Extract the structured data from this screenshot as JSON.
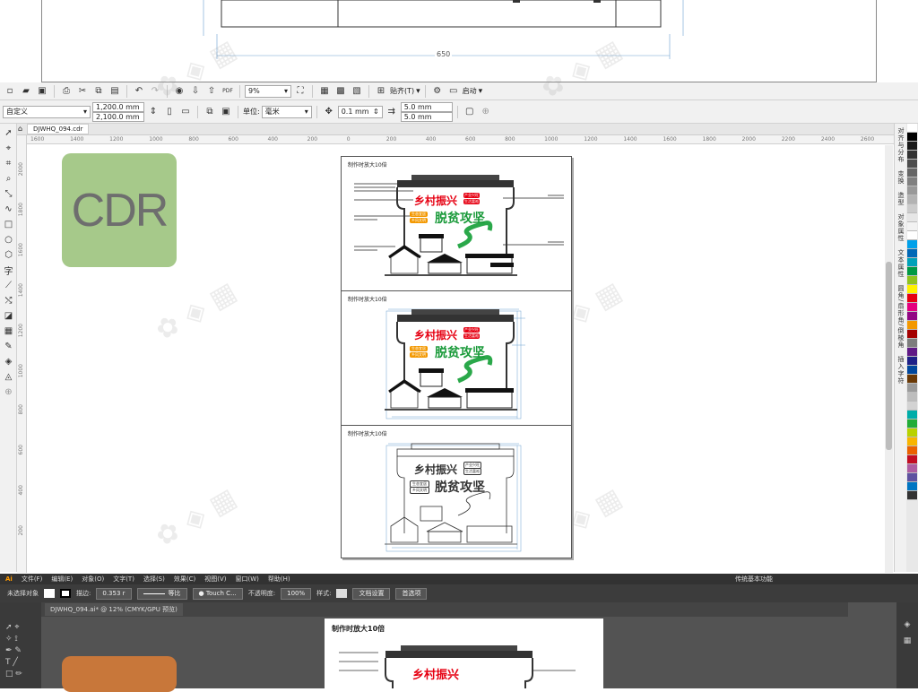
{
  "top_drawing": {
    "dimension_value": "650"
  },
  "cd_toolbar1": {
    "zoom": "9%",
    "paste_label": "贴齐(T)",
    "startup_label": "启动"
  },
  "cd_toolbar2": {
    "preset": "自定义",
    "width": "1,200.0 mm",
    "height": "2,100.0 mm",
    "unit_label": "单位:",
    "unit_value": "毫米",
    "nudge": "0.1 mm",
    "dup_x": "5.0 mm",
    "dup_y": "5.0 mm"
  },
  "cd_doc_tab": {
    "name": "DJWHQ_094.cdr"
  },
  "ruler_h_ticks": [
    "1600",
    "1400",
    "1200",
    "1000",
    "800",
    "600",
    "400",
    "200",
    "0",
    "200",
    "400",
    "600",
    "800",
    "1000",
    "1200",
    "1400",
    "1600",
    "1800",
    "2000",
    "2200",
    "2400",
    "2600"
  ],
  "ruler_v_ticks": [
    "2000",
    "1800",
    "1600",
    "1400",
    "1200",
    "1000",
    "800",
    "600",
    "400",
    "200"
  ],
  "cdr_badge": {
    "text": "CDR",
    "color": "#a6c98a"
  },
  "artboard_sections": [
    {
      "label": "制作时放大10倍",
      "title1": "乡村振兴",
      "title2": "脱贫攻坚",
      "tag1": "产业兴旺",
      "tag2": "生活富裕",
      "tag3": "生态宜居",
      "tag4": "乡风文明"
    },
    {
      "label": "制作时放大10倍",
      "title1": "乡村振兴",
      "title2": "脱贫攻坚",
      "tag1": "产业兴旺",
      "tag2": "生活富裕",
      "tag3": "生态宜居",
      "tag4": "乡风文明"
    },
    {
      "label": "制作时放大10倍",
      "title1": "乡村振兴",
      "title2": "脱贫攻坚",
      "tag1": "产业兴旺",
      "tag2": "生活富裕",
      "tag3": "生态宜居",
      "tag4": "乡风文明"
    }
  ],
  "dockers": [
    "对齐与分布",
    "变换",
    "造型",
    "对象属性",
    "文本属性",
    "圆角/扇形角/倒棱角",
    "插入字符"
  ],
  "palette": [
    "#ffffff",
    "#000000",
    "#1a1a1a",
    "#333333",
    "#4d4d4d",
    "#666666",
    "#808080",
    "#999999",
    "#b3b3b3",
    "#cccccc",
    "#e6e6e6",
    "#f2f2f2",
    "#ffffff",
    "#00a0e9",
    "#0068b7",
    "#00a1b9",
    "#009944",
    "#8fc31f",
    "#fff100",
    "#e60012",
    "#e4007f",
    "#920783",
    "#f39800",
    "#a40000",
    "#7d7d7d",
    "#601986",
    "#1d2088",
    "#00479d",
    "#6a3906",
    "#9b9b9b",
    "#bdbdbd",
    "#d3d3d3",
    "#00ada9",
    "#22ac38",
    "#b8d200",
    "#f8b500",
    "#eb6100",
    "#c30d23",
    "#ae5da1",
    "#5f52a0",
    "#0075c2",
    "#333"
  ],
  "ai": {
    "menu": [
      "文件(F)",
      "编辑(E)",
      "对象(O)",
      "文字(T)",
      "选择(S)",
      "效果(C)",
      "视图(V)",
      "窗口(W)",
      "帮助(H)"
    ],
    "right_menu": "传统基本功能",
    "no_selection": "未选择对象",
    "stroke_label": "描边:",
    "stroke_value": "0.353 r",
    "stroke_style": "等比",
    "brush": "Touch C...",
    "opacity_label": "不透明度:",
    "opacity_value": "100%",
    "style_label": "样式:",
    "doc_settings": "文档设置",
    "prefs": "首选项",
    "doc_tab": "DJWHQ_094.ai* @ 12% (CMYK/GPU 预览)",
    "artboard_label": "制作时放大10倍",
    "artboard_title": "乡村振兴",
    "badge_color": "#c8773a"
  }
}
